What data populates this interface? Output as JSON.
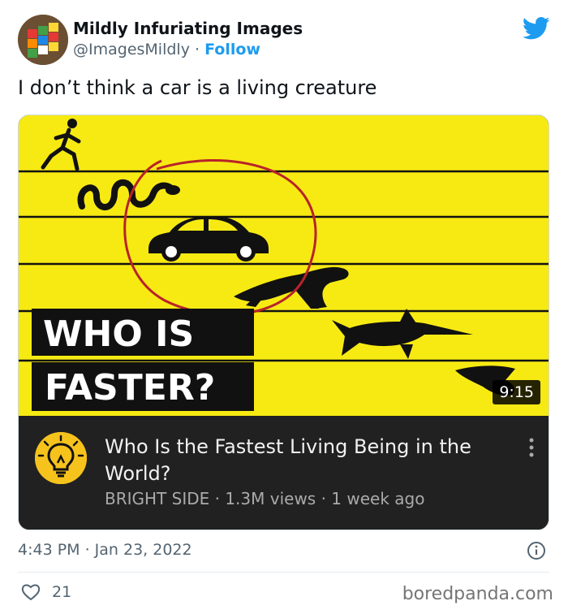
{
  "tweet": {
    "author_name": "Mildly Infuriating Images",
    "handle": "@ImagesMildly",
    "separator": "·",
    "follow_label": "Follow",
    "text": "I don’t think a car is a living creature",
    "timestamp": "4:43 PM · Jan 23, 2022",
    "like_count": "21"
  },
  "video": {
    "overlay_line1": "WHO IS",
    "overlay_line2": "FASTER?",
    "duration": "9:15",
    "title": "Who Is the Fastest Living Being in the World?",
    "meta": "BRIGHT SIDE · 1.3M views · 1 week ago"
  },
  "watermark": "boredpanda.com",
  "colors": {
    "twitter_blue": "#1d9bf0",
    "thumbnail_yellow": "#f7ea13",
    "youtube_dark": "#212121",
    "circle_red": "#b8232a"
  },
  "icons": [
    "twitter-bird-icon",
    "lightbulb-icon",
    "more-vertical-icon",
    "info-icon",
    "heart-icon"
  ]
}
